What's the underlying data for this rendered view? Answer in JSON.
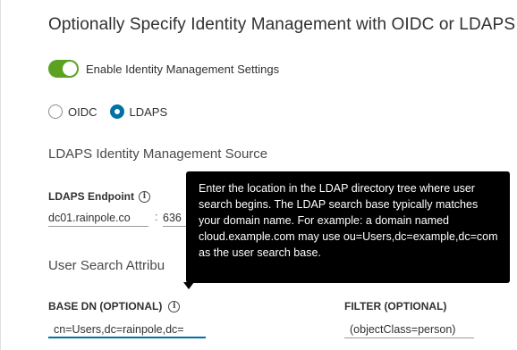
{
  "page": {
    "title": "Optionally Specify Identity Management with OIDC or LDAPS"
  },
  "identity": {
    "toggle_label": "Enable Identity Management Settings",
    "toggle_on": true,
    "protocol_options": [
      {
        "label": "OIDC",
        "selected": false
      },
      {
        "label": "LDAPS",
        "selected": true
      }
    ]
  },
  "ldaps": {
    "section_title": "LDAPS Identity Management Source",
    "endpoint_label": "LDAPS Endpoint",
    "endpoint_host": "dc01.rainpole.co",
    "endpoint_separator": ":",
    "endpoint_port": "636",
    "user_search_title": "User Search Attribu",
    "base_dn_label": "BASE DN (OPTIONAL)",
    "base_dn_value": "cn=Users,dc=rainpole,dc=",
    "filter_label": "FILTER (OPTIONAL)",
    "filter_value": "(objectClass=person)"
  },
  "tooltip": {
    "text": "Enter the location in the LDAP directory tree where user search begins. The LDAP search base typically matches your domain name. For example: a domain named cloud.example.com may use ou=Users,dc=example,dc=com as the user search base."
  },
  "icons": {
    "info": "info-icon"
  },
  "colors": {
    "toggle_on": "#5aa220",
    "radio_selected": "#0072a3",
    "input_focus": "#0072a3",
    "tooltip_bg": "#000000"
  }
}
